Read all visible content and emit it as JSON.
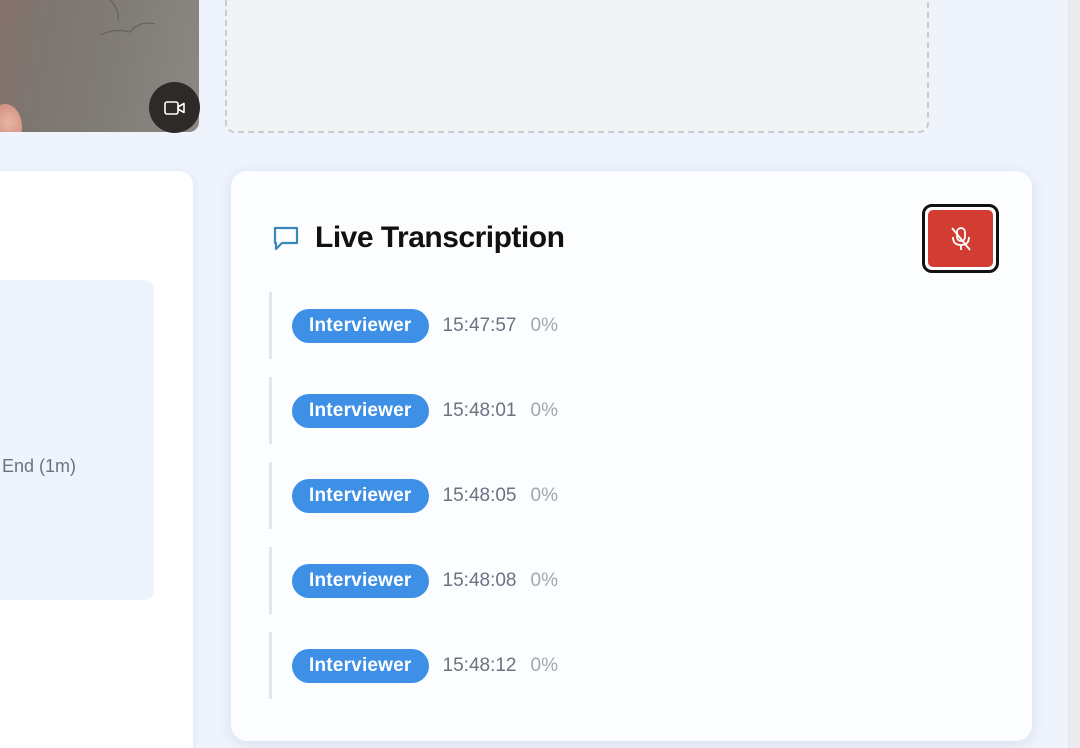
{
  "video": {
    "camera_icon": "video-camera-icon"
  },
  "left_panel": {
    "text": "End (1m)"
  },
  "transcription": {
    "title": "Live Transcription",
    "title_icon": "chat-bubble-icon",
    "mute_button_icon": "mic-off-icon",
    "accent_color": "#3e8fe6",
    "mute_color": "#d23c33",
    "entries": [
      {
        "speaker": "Interviewer",
        "time": "15:47:57",
        "confidence": "0%"
      },
      {
        "speaker": "Interviewer",
        "time": "15:48:01",
        "confidence": "0%"
      },
      {
        "speaker": "Interviewer",
        "time": "15:48:05",
        "confidence": "0%"
      },
      {
        "speaker": "Interviewer",
        "time": "15:48:08",
        "confidence": "0%"
      },
      {
        "speaker": "Interviewer",
        "time": "15:48:12",
        "confidence": "0%"
      }
    ]
  }
}
